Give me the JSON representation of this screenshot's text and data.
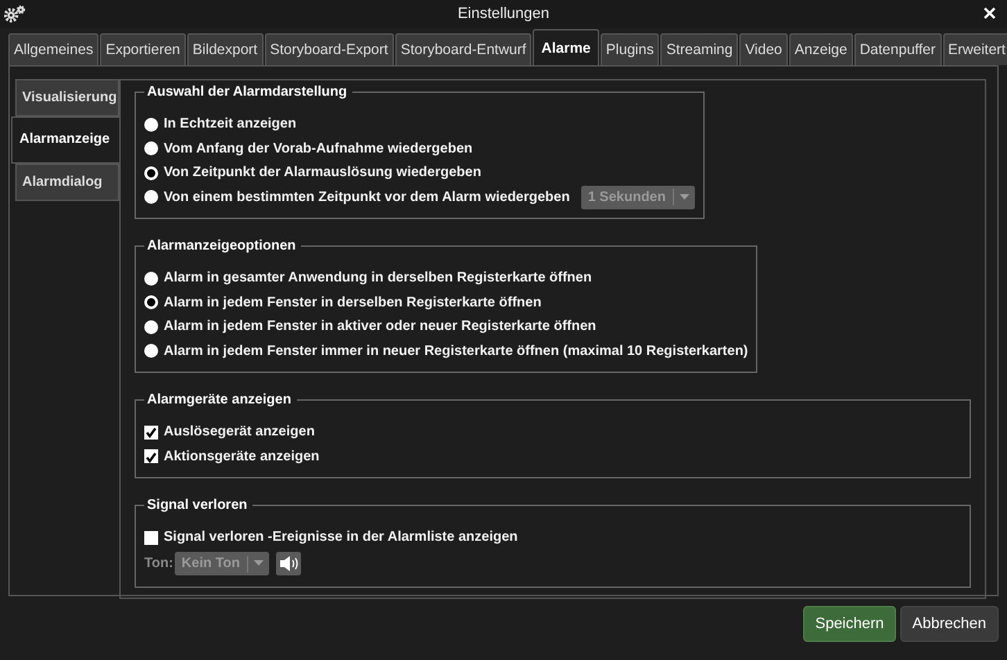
{
  "window": {
    "title": "Einstellungen"
  },
  "tabs": [
    {
      "label": "Allgemeines",
      "selected": false
    },
    {
      "label": "Exportieren",
      "selected": false
    },
    {
      "label": "Bildexport",
      "selected": false
    },
    {
      "label": "Storyboard-Export",
      "selected": false
    },
    {
      "label": "Storyboard-Entwurf",
      "selected": false
    },
    {
      "label": "Alarme",
      "selected": true
    },
    {
      "label": "Plugins",
      "selected": false
    },
    {
      "label": "Streaming",
      "selected": false
    },
    {
      "label": "Video",
      "selected": false
    },
    {
      "label": "Anzeige",
      "selected": false
    },
    {
      "label": "Datenpuffer",
      "selected": false
    },
    {
      "label": "Erweitert",
      "selected": false
    }
  ],
  "side_tabs": [
    {
      "label": "Visualisierung",
      "selected": false
    },
    {
      "label": "Alarmanzeige",
      "selected": true
    },
    {
      "label": "Alarmdialog",
      "selected": false
    }
  ],
  "groups": [
    {
      "title": "Auswahl der Alarmdarstellung",
      "items": [
        {
          "kind": "radio",
          "label": "In Echtzeit anzeigen",
          "selected": false
        },
        {
          "kind": "radio",
          "label": "Vom Anfang der Vorab-Aufnahme wiedergeben",
          "selected": false
        },
        {
          "kind": "radio",
          "label": "Von Zeitpunkt der Alarmauslösung wiedergeben",
          "selected": true
        },
        {
          "kind": "radio",
          "label": "Von einem bestimmten Zeitpunkt vor dem Alarm wiedergeben",
          "selected": false,
          "dropdown": {
            "value": "1 Sekunden",
            "disabled": true
          }
        }
      ]
    },
    {
      "title": "Alarmanzeigeoptionen",
      "items": [
        {
          "kind": "radio",
          "label": "Alarm in gesamter Anwendung in derselben Registerkarte öffnen",
          "selected": false
        },
        {
          "kind": "radio",
          "label": "Alarm in jedem Fenster in derselben Registerkarte öffnen",
          "selected": true
        },
        {
          "kind": "radio",
          "label": "Alarm in jedem Fenster in aktiver oder neuer Registerkarte öffnen",
          "selected": false
        },
        {
          "kind": "radio",
          "label": "Alarm in jedem Fenster immer in neuer Registerkarte öffnen (maximal 10 Registerkarten)",
          "selected": false
        }
      ]
    },
    {
      "title": "Alarmgeräte anzeigen",
      "items": [
        {
          "kind": "checkbox",
          "label": "Auslösegerät anzeigen",
          "checked": true
        },
        {
          "kind": "checkbox",
          "label": "Aktionsgeräte anzeigen",
          "checked": true
        }
      ]
    },
    {
      "title": "Signal verloren",
      "items": [
        {
          "kind": "checkbox",
          "label": "Signal verloren -Ereignisse in der Alarmliste anzeigen",
          "checked": false
        },
        {
          "kind": "sound",
          "label": "Ton:",
          "dropdown": {
            "value": "Kein Ton",
            "disabled": true
          }
        }
      ]
    }
  ],
  "buttons": [
    {
      "label": "Speichern",
      "kind": "primary"
    },
    {
      "label": "Abbrechen",
      "kind": "secondary"
    }
  ]
}
